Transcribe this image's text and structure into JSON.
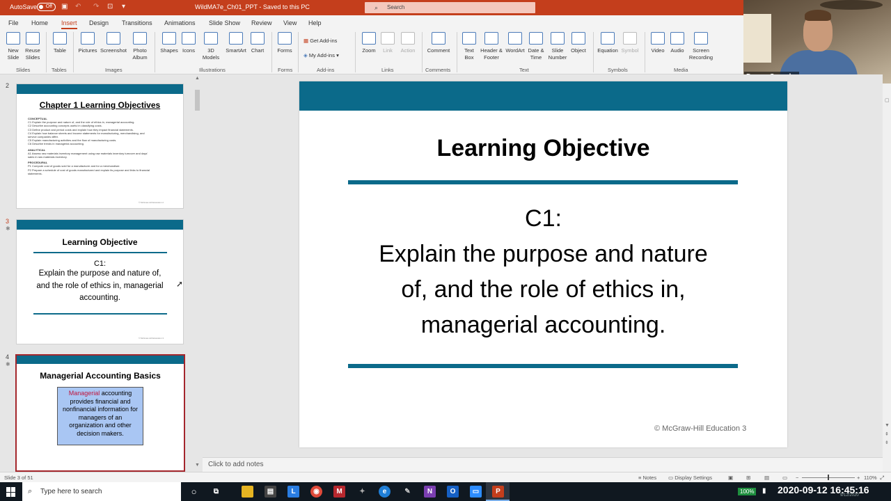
{
  "titlebar": {
    "autosave_label": "AutoSave",
    "autosave_state": "Off",
    "document_title": "WildMA7e_Ch01_PPT  -  Saved to this PC",
    "search_placeholder": "Search",
    "search_icon": "magnifier-icon"
  },
  "menu": {
    "tabs": [
      "File",
      "Home",
      "Insert",
      "Design",
      "Transitions",
      "Animations",
      "Slide Show",
      "Review",
      "View",
      "Help"
    ],
    "active": "Insert"
  },
  "ribbon": {
    "buttons": {
      "new_slide": "New Slide",
      "reuse_slides": "Reuse Slides",
      "table": "Table",
      "pictures": "Pictures",
      "screenshot": "Screenshot",
      "photo_album": "Photo Album",
      "shapes": "Shapes",
      "icons": "Icons",
      "models_3d": "3D Models",
      "smartart": "SmartArt",
      "chart": "Chart",
      "forms": "Forms",
      "get_addins": "Get Add-ins",
      "my_addins": "My Add-ins",
      "zoom": "Zoom",
      "link": "Link",
      "action": "Action",
      "comment": "Comment",
      "text_box": "Text Box",
      "header_footer": "Header & Footer",
      "wordart": "WordArt",
      "date_time": "Date & Time",
      "slide_number": "Slide Number",
      "object": "Object",
      "equation": "Equation",
      "symbol": "Symbol",
      "video": "Video",
      "audio": "Audio",
      "screen_recording": "Screen Recording"
    },
    "groups": {
      "slides": "Slides",
      "tables": "Tables",
      "images": "Images",
      "illustrations": "Illustrations",
      "forms": "Forms",
      "addins": "Add-ins",
      "links": "Links",
      "comments": "Comments",
      "text": "Text",
      "symbols": "Symbols",
      "media": "Media"
    }
  },
  "webcam": {
    "participant_name": "Devon Coombs"
  },
  "thumbnails": [
    {
      "number": "2",
      "title": "Chapter 1 Learning Objectives",
      "sections": [
        {
          "heading": "CONCEPTUAL",
          "lines": [
            "C1  Explain the purpose and nature of, and the role of ethics in, managerial accounting.",
            "C2  Describe accounting concepts useful in classifying costs.",
            "C3  Define product and period costs and explain how they impact financial statements.",
            "C4  Explain how balance sheets and income statements for manufacturing, merchandising, and",
            "      service companies differ.",
            "C5  Explain manufacturing activities and the flow of manufacturing costs.",
            "C6  Describe trends in managerial accounting."
          ]
        },
        {
          "heading": "ANALYTICAL",
          "lines": [
            "A1  Assess raw materials inventory management using raw materials inventory turnover and days'",
            "      sales in raw materials inventory."
          ]
        },
        {
          "heading": "PROCEDURAL",
          "lines": [
            "P1  Compute cost of goods sold for a manufacturer and for a merchandiser.",
            "P2  Prepare a schedule of cost of goods manufactured and explain its purpose and links to financial",
            "      statements."
          ]
        }
      ],
      "footer": "© McGraw-Hill Education   2"
    },
    {
      "number": "3",
      "title": "Learning Objective",
      "code": "C1:",
      "text": "Explain the purpose and nature of, and the role of ethics in, managerial accounting.",
      "footer": "© McGraw-Hill Education   3"
    },
    {
      "number": "4",
      "title": "Managerial Accounting Basics",
      "highlight": "Managerial",
      "box_text": " accounting provides financial and nonfinancial information for managers of an organization and other decision makers."
    }
  ],
  "slide": {
    "title": "Learning Objective",
    "code": "C1:",
    "lines": [
      "Explain the purpose and nature",
      "of, and the role of ethics in,",
      "managerial accounting."
    ],
    "footer": "© McGraw-Hill Education   3"
  },
  "notes": {
    "placeholder": "Click to add notes"
  },
  "status": {
    "slide_position": "Slide 3 of 51",
    "notes_label": "Notes",
    "display_settings": "Display Settings",
    "zoom": "110%"
  },
  "taskbar": {
    "search_placeholder": "Type here to search",
    "battery": "100%",
    "datetime": "2020-09-12  16:45:16",
    "faint_date": "9/12/2020"
  },
  "colors": {
    "accent": "#c43e1c",
    "slide_bar": "#0b6a8a",
    "selected_border": "#a4262c"
  }
}
